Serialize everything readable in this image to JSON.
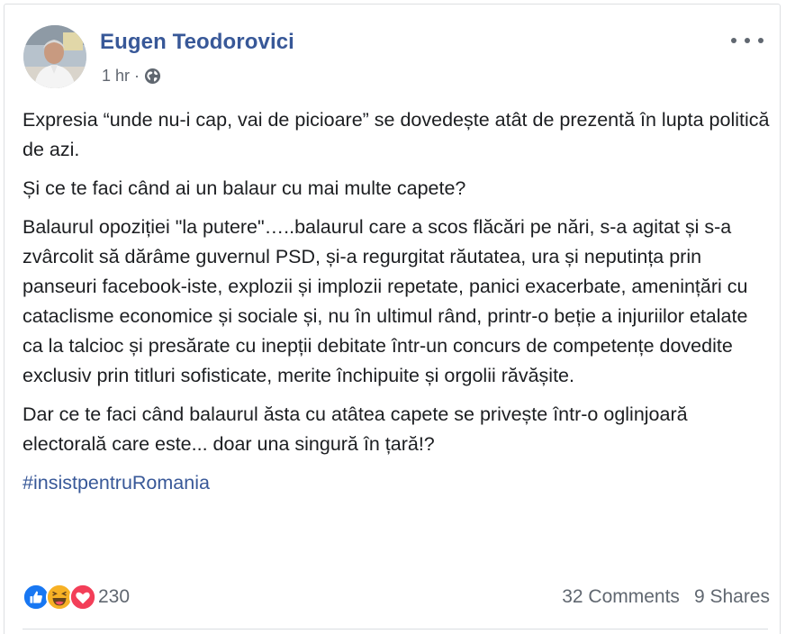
{
  "post": {
    "author": "Eugen Teodorovici",
    "time": "1 hr",
    "separator": "·",
    "privacy_icon": "globe-icon",
    "paragraphs": [
      "Expresia “unde nu-i cap, vai de picioare” se dovedește atât de prezentă în lupta politică de azi.",
      "Și ce te faci când ai un balaur cu mai multe capete?",
      "Balaurul opoziției \"la putere\"…..balaurul care a scos flăcări pe nări, s-a agitat și s-a zvârcolit să dărâme guvernul PSD, și-a regurgitat răutatea, ura și neputința prin panseuri facebook-iste, explozii și implozii repetate, panici exacerbate, amenințări cu cataclisme economice și sociale și, nu în ultimul rând, printr-o beție a injuriilor etalate ca la talcioc și presărate cu inepții debitate într-un concurs de competențe dovedite exclusiv prin titluri sofisticate, merite închipuite și orgolii răvășite.",
      "Dar ce te faci când balaurul ăsta cu atâtea capete se privește într-o oglinjoară electorală care este... doar una singură în țară!?"
    ],
    "hashtag": "#insistpentruRomania"
  },
  "footer": {
    "reaction_icons": [
      "like-icon",
      "haha-icon",
      "love-icon"
    ],
    "reaction_count": "230",
    "comments": "32 Comments",
    "shares": "9 Shares"
  },
  "colors": {
    "link": "#385898",
    "text": "#1c1e21",
    "muted": "#606770",
    "like": "#1877f2",
    "haha": "#f7b125",
    "love": "#f33e58"
  }
}
